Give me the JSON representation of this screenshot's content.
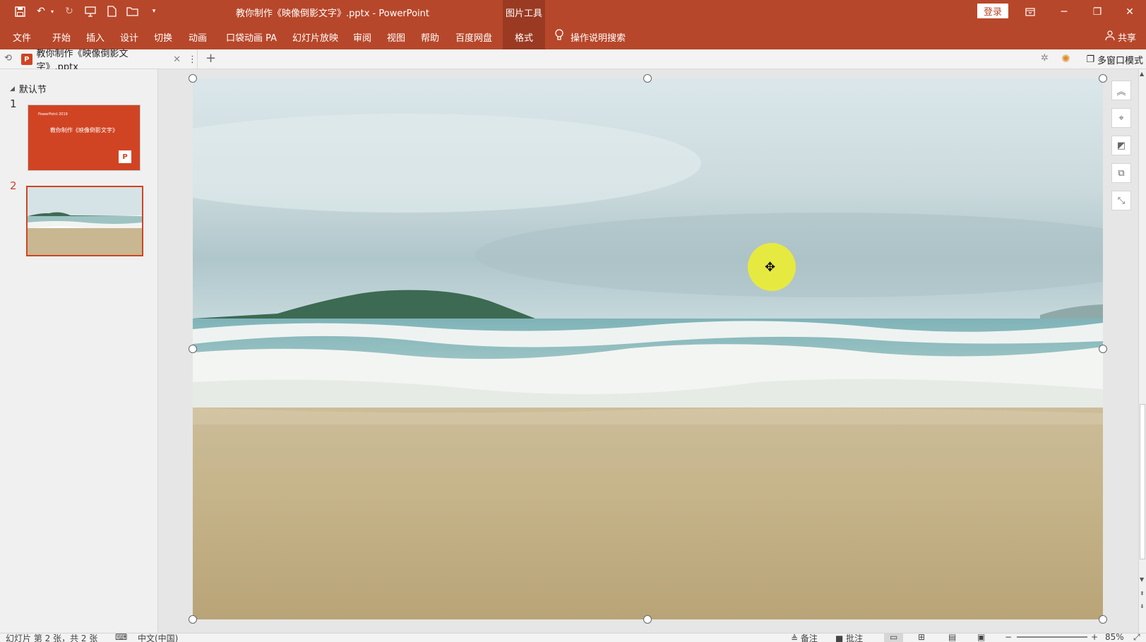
{
  "titlebar": {
    "title": "教你制作《映像倒影文字》.pptx  -  PowerPoint",
    "context_tab": "图片工具",
    "login": "登录",
    "qa_icons": [
      "save-icon",
      "undo-icon",
      "redo-icon",
      "presenter-icon",
      "new-file-icon",
      "open-folder-icon",
      "customize-icon"
    ]
  },
  "ribbon": {
    "tabs": [
      "文件",
      "开始",
      "插入",
      "设计",
      "切换",
      "动画",
      "口袋动画 PA",
      "幻灯片放映",
      "审阅",
      "视图",
      "帮助",
      "百度网盘",
      "格式"
    ],
    "active_tab": "格式",
    "search": "操作说明搜索",
    "share": "共享"
  },
  "docbar": {
    "tab_title": "教你制作《映像倒影文字》.pptx",
    "multi_window": "多窗口模式"
  },
  "thumbnails": {
    "section": "默认节",
    "slides": [
      {
        "number": "1",
        "title": "教你制作《映像倒影文字》"
      },
      {
        "number": "2",
        "title": ""
      }
    ],
    "selected": 2
  },
  "statusbar": {
    "slide_info": "幻灯片 第 2 张，共 2 张",
    "language": "中文(中国)",
    "notes": "备注",
    "comments": "批注",
    "zoom": "85%"
  },
  "colors": {
    "accent": "#b7472a",
    "selection": "#d04423",
    "cursor_highlight": "#f0f028"
  }
}
